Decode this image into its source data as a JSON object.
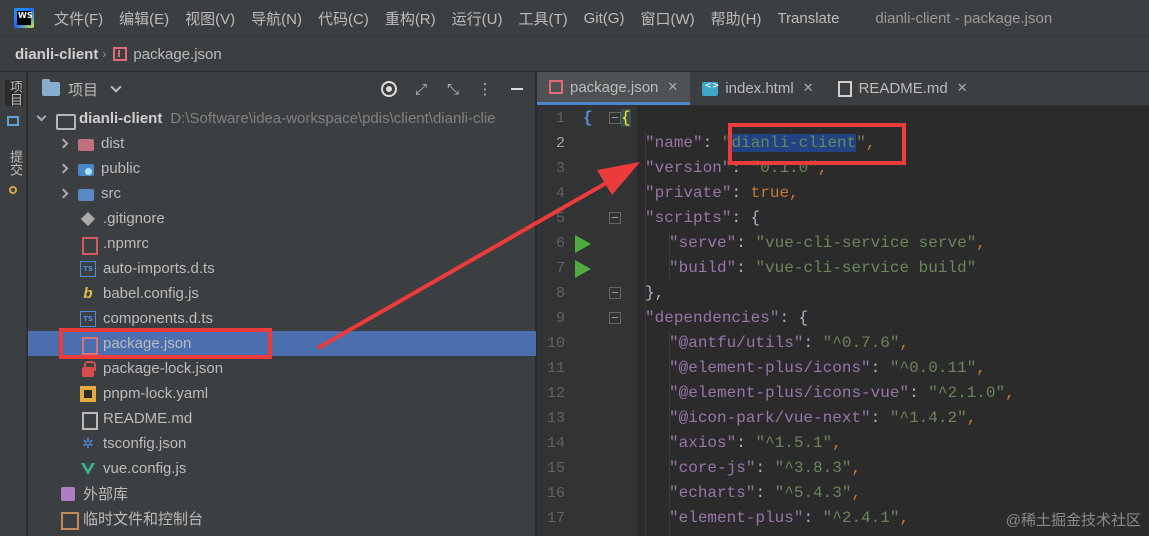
{
  "menubar": {
    "logo_text": "WS",
    "items": [
      "文件(F)",
      "编辑(E)",
      "视图(V)",
      "导航(N)",
      "代码(C)",
      "重构(R)",
      "运行(U)",
      "工具(T)",
      "Git(G)",
      "窗口(W)",
      "帮助(H)",
      "Translate"
    ],
    "window_title": "dianli-client - package.json"
  },
  "breadcrumb": {
    "root": "dianli-client",
    "separator": "›",
    "file": "package.json"
  },
  "toolstrip": {
    "project_label": "项目",
    "commit_label": "提交"
  },
  "project_panel": {
    "title": "项目",
    "tree": [
      {
        "label": "dianli-client",
        "path": "D:\\Software\\idea-workspace\\pdis\\client\\dianli-clie",
        "icon": "folder-icon",
        "arrow": "open"
      },
      {
        "label": "dist",
        "icon": "dist-folder-icon",
        "arrow": "closed"
      },
      {
        "label": "public",
        "icon": "public-folder-icon",
        "arrow": "closed"
      },
      {
        "label": "src",
        "icon": "src-folder-icon",
        "arrow": "closed"
      },
      {
        "label": ".gitignore",
        "icon": "git-icon"
      },
      {
        "label": ".npmrc",
        "icon": "npm-icon"
      },
      {
        "label": "auto-imports.d.ts",
        "icon": "ts-icon"
      },
      {
        "label": "babel.config.js",
        "icon": "babel-icon"
      },
      {
        "label": "components.d.ts",
        "icon": "ts-icon"
      },
      {
        "label": "package.json",
        "icon": "json-icon",
        "selected": true
      },
      {
        "label": "package-lock.json",
        "icon": "lock-icon"
      },
      {
        "label": "pnpm-lock.yaml",
        "icon": "yaml-icon"
      },
      {
        "label": "README.md",
        "icon": "readme-icon"
      },
      {
        "label": "tsconfig.json",
        "icon": "tsconfig-icon"
      },
      {
        "label": "vue.config.js",
        "icon": "vue-icon"
      },
      {
        "label": "外部库",
        "icon": "library-icon"
      },
      {
        "label": "临时文件和控制台",
        "icon": "scratch-icon"
      }
    ]
  },
  "tabs": [
    {
      "label": "package.json",
      "icon": "json-icon",
      "active": true
    },
    {
      "label": "index.html",
      "icon": "html-icon",
      "active": false
    },
    {
      "label": "README.md",
      "icon": "markdown-icon",
      "active": false
    }
  ],
  "editor": {
    "lines": [
      {
        "n": "1",
        "text": "{"
      },
      {
        "n": "2",
        "key": "name",
        "value": "dianli-client"
      },
      {
        "n": "3",
        "key": "version",
        "value": "0.1.0"
      },
      {
        "n": "4",
        "key": "private",
        "value": "true"
      },
      {
        "n": "5",
        "key": "scripts",
        "value": "{"
      },
      {
        "n": "6",
        "key": "serve",
        "value": "vue-cli-service serve"
      },
      {
        "n": "7",
        "key": "build",
        "value": "vue-cli-service build"
      },
      {
        "n": "8",
        "text": "},"
      },
      {
        "n": "9",
        "key": "dependencies",
        "value": "{"
      },
      {
        "n": "10",
        "key": "@antfu/utils",
        "value": "^0.7.6"
      },
      {
        "n": "11",
        "key": "@element-plus/icons",
        "value": "^0.0.11"
      },
      {
        "n": "12",
        "key": "@element-plus/icons-vue",
        "value": "^2.1.0"
      },
      {
        "n": "13",
        "key": "@icon-park/vue-next",
        "value": "^1.4.2"
      },
      {
        "n": "14",
        "key": "axios",
        "value": "^1.5.1"
      },
      {
        "n": "15",
        "key": "core-js",
        "value": "^3.8.3"
      },
      {
        "n": "16",
        "key": "echarts",
        "value": "^5.4.3"
      },
      {
        "n": "17",
        "key": "element-plus",
        "value": "^2.4.1"
      }
    ]
  },
  "watermark": "@稀土掘金技术社区",
  "colors": {
    "annotation": "#ec3b3b",
    "selection": "#4b6eaf",
    "accent": "#4a88c7"
  }
}
